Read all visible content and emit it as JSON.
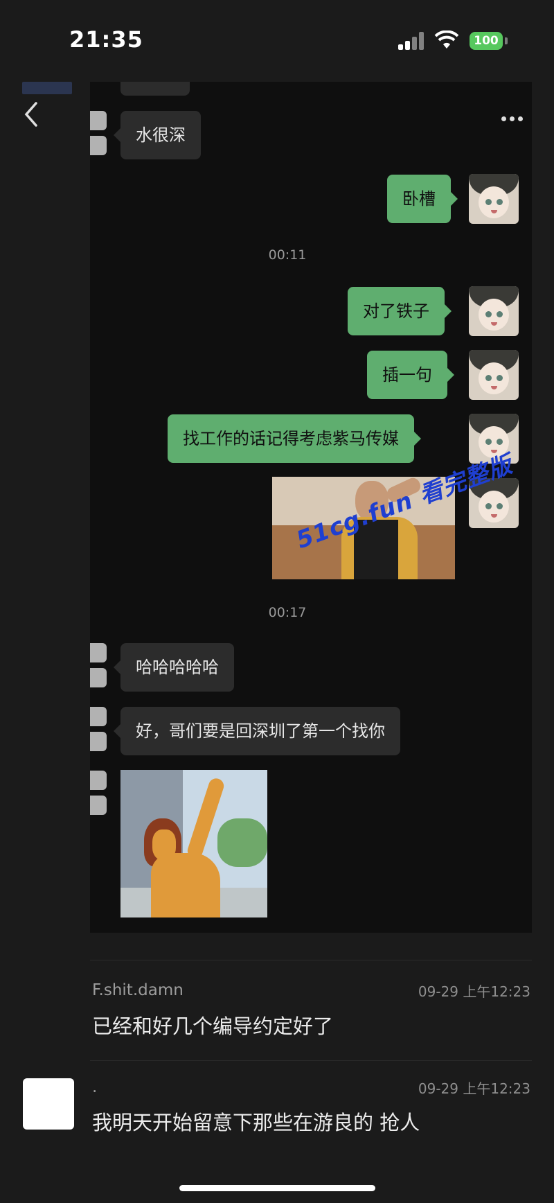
{
  "status_bar": {
    "time": "21:35",
    "battery": "100"
  },
  "messages": [
    {
      "side": "in",
      "text": "水很深"
    },
    {
      "side": "out",
      "text": "卧槽"
    },
    {
      "side": "time",
      "text": "00:11"
    },
    {
      "side": "out",
      "text": "对了铁子"
    },
    {
      "side": "out",
      "text": "插一句"
    },
    {
      "side": "out",
      "text": "找工作的话记得考虑紫马传媒"
    },
    {
      "side": "time",
      "text": "00:17"
    },
    {
      "side": "in",
      "text": "哈哈哈哈哈"
    },
    {
      "side": "in",
      "text": "好，哥们要是回深圳了第一个找你"
    }
  ],
  "watermark": "51cg.fun 看完整版",
  "comments": [
    {
      "name": "F.shit.damn",
      "time": "09-29 上午12:23",
      "text": "已经和好几个编导约定好了"
    },
    {
      "name": ".",
      "time": "09-29 上午12:23",
      "text": "我明天开始留意下那些在游良的 抢人"
    }
  ],
  "colors": {
    "outgoing": "#5fae6f",
    "incoming": "#2c2c2c",
    "background": "#1b1b1b"
  },
  "icons": [
    "back-chevron-icon",
    "more-dots-icon",
    "signal-icon",
    "wifi-icon",
    "battery-icon"
  ]
}
